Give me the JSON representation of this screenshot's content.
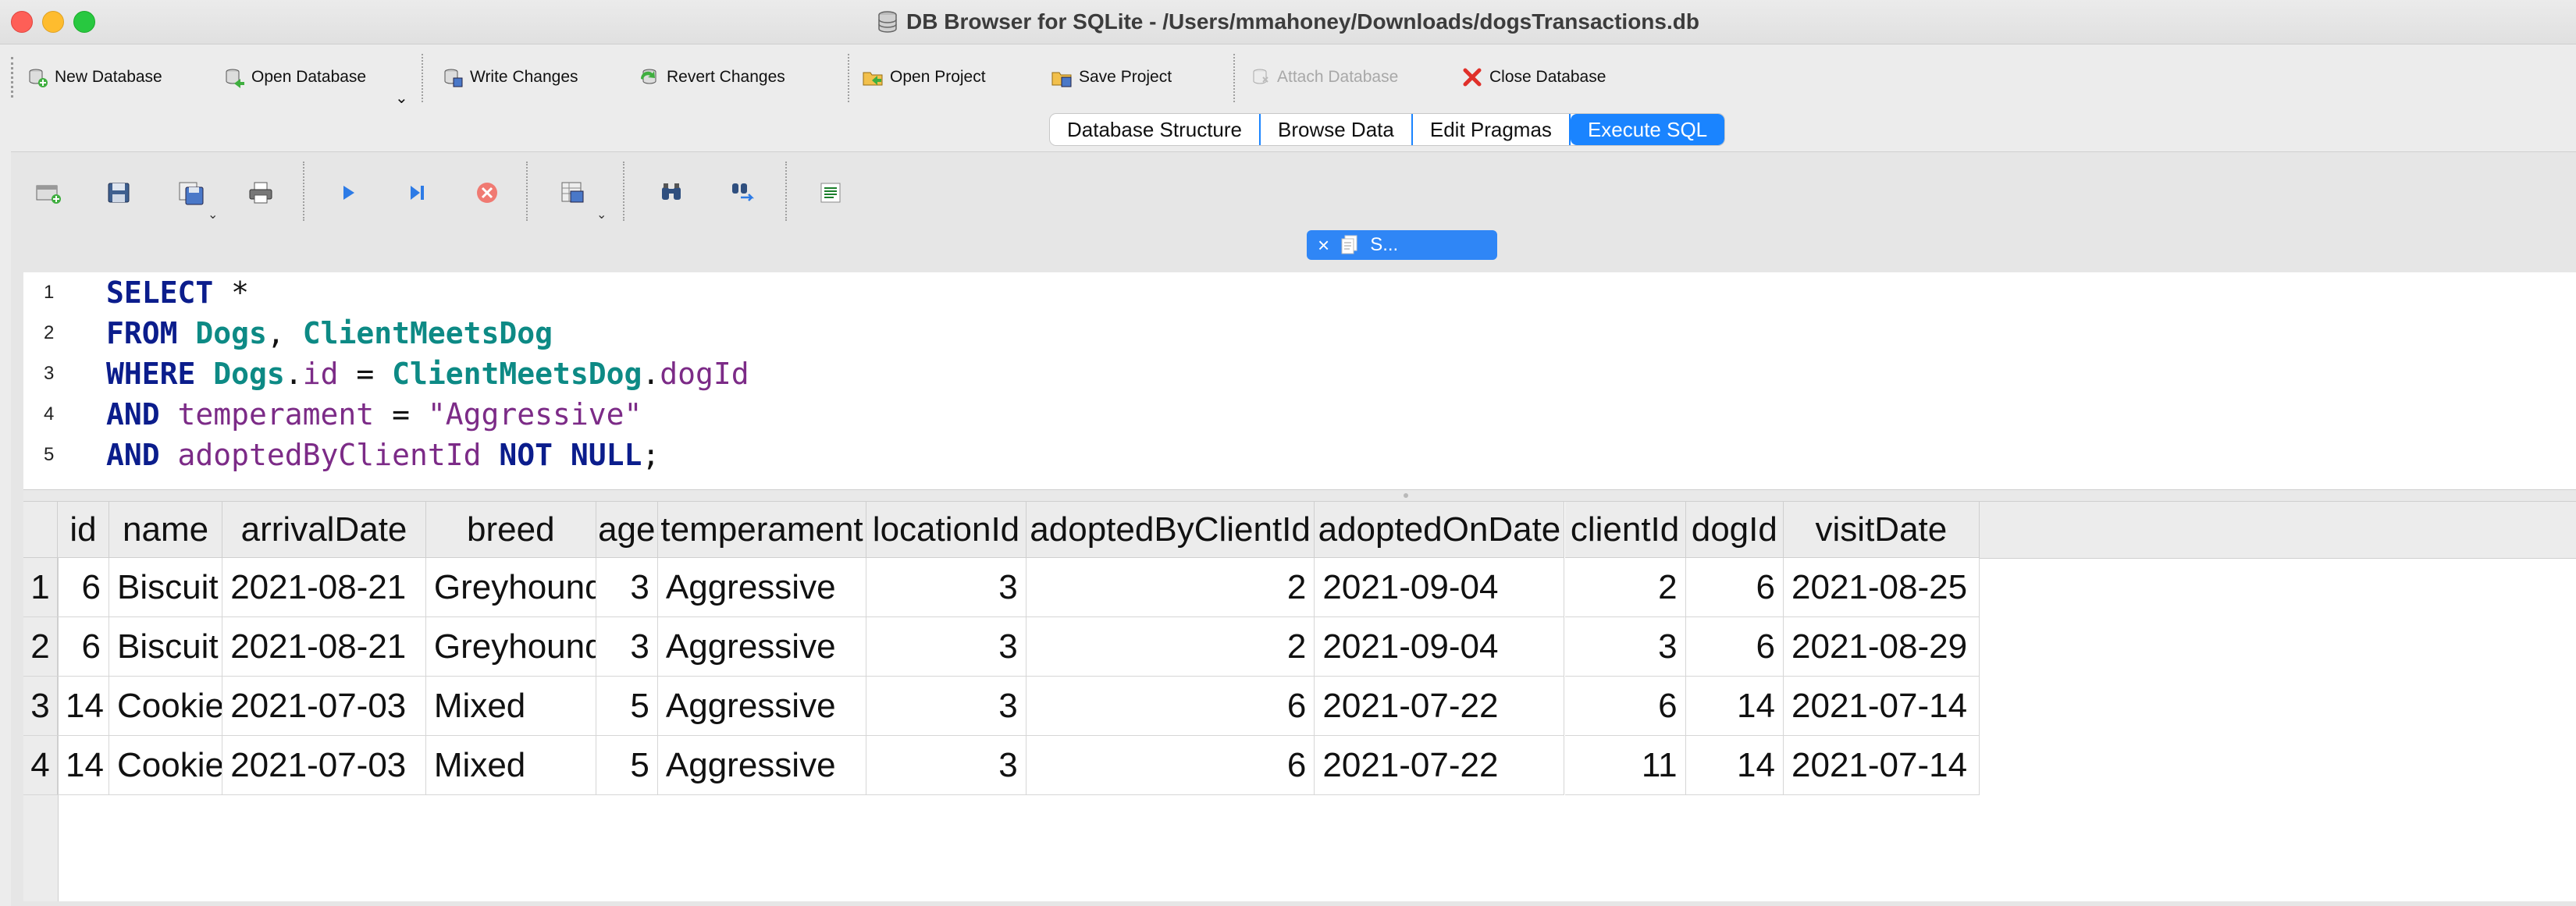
{
  "window": {
    "title": "DB Browser for SQLite - /Users/mmahoney/Downloads/dogsTransactions.db"
  },
  "toolbar": {
    "new_database": "New Database",
    "open_database": "Open Database",
    "write_changes": "Write Changes",
    "revert_changes": "Revert Changes",
    "open_project": "Open Project",
    "save_project": "Save Project",
    "attach_database": "Attach Database",
    "close_database": "Close Database"
  },
  "tabs": [
    {
      "label": "Database Structure"
    },
    {
      "label": "Browse Data"
    },
    {
      "label": "Edit Pragmas"
    },
    {
      "label": "Execute SQL"
    }
  ],
  "editor_tab": {
    "label": "S..."
  },
  "editor": {
    "line_numbers": [
      "1",
      "2",
      "3",
      "4",
      "5"
    ],
    "lines": [
      [
        {
          "t": "SELECT",
          "c": "kw"
        },
        {
          "t": " *",
          "c": "plain"
        }
      ],
      [
        {
          "t": "FROM",
          "c": "kw"
        },
        {
          "t": " ",
          "c": "plain"
        },
        {
          "t": "Dogs",
          "c": "tbl"
        },
        {
          "t": ", ",
          "c": "plain"
        },
        {
          "t": "ClientMeetsDog",
          "c": "tbl"
        }
      ],
      [
        {
          "t": "WHERE",
          "c": "kw"
        },
        {
          "t": " ",
          "c": "plain"
        },
        {
          "t": "Dogs",
          "c": "tbl"
        },
        {
          "t": ".",
          "c": "plain"
        },
        {
          "t": "id",
          "c": "fld"
        },
        {
          "t": " = ",
          "c": "plain"
        },
        {
          "t": "ClientMeetsDog",
          "c": "tbl"
        },
        {
          "t": ".",
          "c": "plain"
        },
        {
          "t": "dogId",
          "c": "fld"
        }
      ],
      [
        {
          "t": "AND",
          "c": "kw"
        },
        {
          "t": " ",
          "c": "plain"
        },
        {
          "t": "temperament",
          "c": "fld"
        },
        {
          "t": " = ",
          "c": "plain"
        },
        {
          "t": "\"Aggressive\"",
          "c": "str"
        }
      ],
      [
        {
          "t": "AND",
          "c": "kw"
        },
        {
          "t": " ",
          "c": "plain"
        },
        {
          "t": "adoptedByClientId",
          "c": "fld"
        },
        {
          "t": " ",
          "c": "plain"
        },
        {
          "t": "NOT",
          "c": "kw"
        },
        {
          "t": " ",
          "c": "plain"
        },
        {
          "t": "NULL",
          "c": "kw"
        },
        {
          "t": ";",
          "c": "plain"
        }
      ]
    ]
  },
  "results": {
    "columns": [
      "id",
      "name",
      "arrivalDate",
      "breed",
      "age",
      "temperament",
      "locationId",
      "adoptedByClientId",
      "adoptedOnDate",
      "clientId",
      "dogId",
      "visitDate"
    ],
    "row_numbers": [
      "1",
      "2",
      "3",
      "4"
    ],
    "rows": [
      [
        "6",
        "Biscuit",
        "2021-08-21",
        "Greyhound",
        "3",
        "Aggressive",
        "3",
        "2",
        "2021-09-04",
        "2",
        "6",
        "2021-08-25"
      ],
      [
        "6",
        "Biscuit",
        "2021-08-21",
        "Greyhound",
        "3",
        "Aggressive",
        "3",
        "2",
        "2021-09-04",
        "3",
        "6",
        "2021-08-29"
      ],
      [
        "14",
        "Cookie",
        "2021-07-03",
        "Mixed",
        "5",
        "Aggressive",
        "3",
        "6",
        "2021-07-22",
        "6",
        "14",
        "2021-07-14"
      ],
      [
        "14",
        "Cookie",
        "2021-07-03",
        "Mixed",
        "5",
        "Aggressive",
        "3",
        "6",
        "2021-07-22",
        "11",
        "14",
        "2021-07-14"
      ]
    ]
  },
  "colors": {
    "accent": "#1a84ff",
    "keyword": "#0b1d8c",
    "table_name": "#0d8a85",
    "field": "#7c2b87"
  }
}
